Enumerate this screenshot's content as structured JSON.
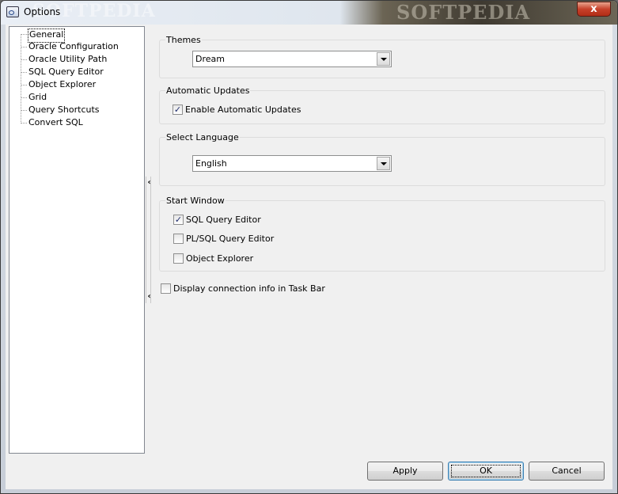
{
  "window": {
    "title": "Options",
    "watermark_left": "SOFTPEDIA",
    "watermark_right": "SOFTPEDIA",
    "close_label": "x"
  },
  "tree": {
    "items": [
      {
        "label": "General",
        "selected": true
      },
      {
        "label": "Oracle Configuration"
      },
      {
        "label": "Oracle Utility Path"
      },
      {
        "label": "SQL Query Editor"
      },
      {
        "label": "Object Explorer"
      },
      {
        "label": "Grid"
      },
      {
        "label": "Query Shortcuts"
      },
      {
        "label": "Convert SQL"
      }
    ]
  },
  "splitter": {
    "arrow_top": "‹",
    "arrow_bottom": "‹"
  },
  "themes": {
    "label": "Themes",
    "value": "Dream"
  },
  "updates": {
    "label": "Automatic Updates",
    "enable_label": "Enable Automatic Updates",
    "enable_checked": true
  },
  "language": {
    "label": "Select Language",
    "value": "English"
  },
  "start_window": {
    "label": "Start Window",
    "options": [
      {
        "label": "SQL Query Editor",
        "checked": true
      },
      {
        "label": "PL/SQL Query Editor",
        "checked": false
      },
      {
        "label": "Object Explorer",
        "checked": false
      }
    ]
  },
  "taskbar": {
    "label": "Display connection info in Task Bar",
    "checked": false
  },
  "buttons": {
    "apply": "Apply",
    "ok": "OK",
    "cancel": "Cancel"
  },
  "check_mark": "✓"
}
